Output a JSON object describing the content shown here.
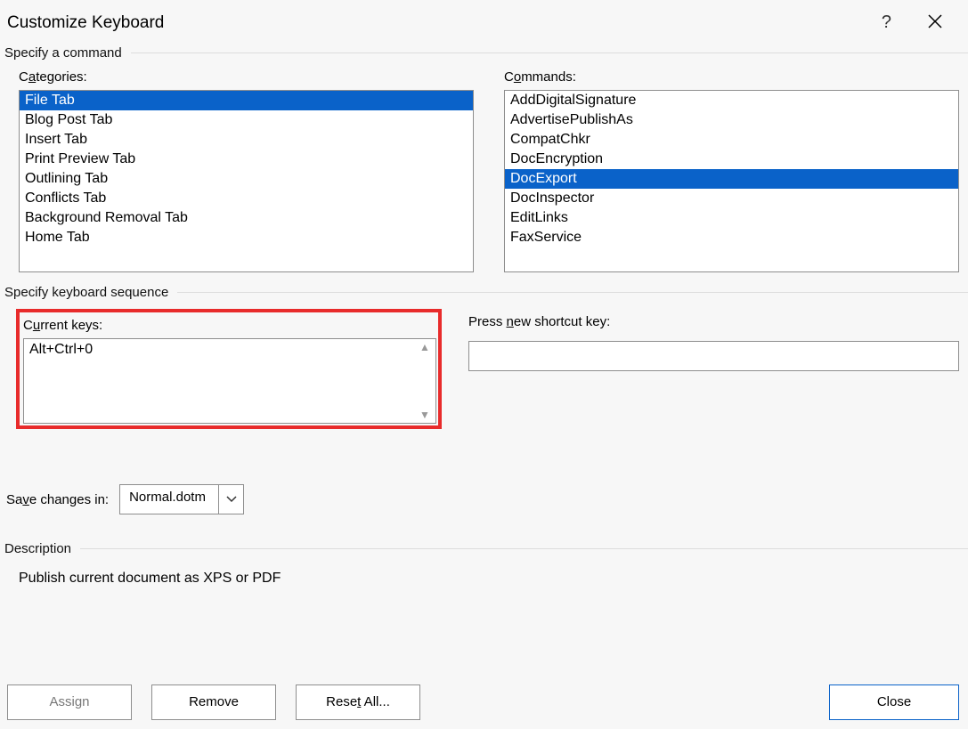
{
  "dialog": {
    "title": "Customize Keyboard"
  },
  "sections": {
    "specify_command": "Specify a command",
    "specify_sequence": "Specify keyboard sequence",
    "description_label": "Description"
  },
  "labels": {
    "categories_pre": "C",
    "categories_u": "a",
    "categories_post": "tegories:",
    "commands_pre": "C",
    "commands_u": "o",
    "commands_post": "mmands:",
    "current_pre": "C",
    "current_u": "u",
    "current_post": "rrent keys:",
    "press_pre": "Press ",
    "press_u": "n",
    "press_post": "ew shortcut key:",
    "savein_pre": "Sa",
    "savein_u": "v",
    "savein_post": "e changes in:"
  },
  "categories": {
    "selected_index": 0,
    "items": [
      "File Tab",
      "Blog Post Tab",
      "Insert Tab",
      "Print Preview Tab",
      "Outlining Tab",
      "Conflicts Tab",
      "Background Removal Tab",
      "Home Tab"
    ]
  },
  "commands": {
    "selected_index": 4,
    "items": [
      "AddDigitalSignature",
      "AdvertisePublishAs",
      "CompatChkr",
      "DocEncryption",
      "DocExport",
      "DocInspector",
      "EditLinks",
      "FaxService"
    ]
  },
  "current_keys": [
    "Alt+Ctrl+0"
  ],
  "new_shortcut": "",
  "save_in": {
    "value": "Normal.dotm"
  },
  "description": "Publish current document as XPS or PDF",
  "buttons": {
    "assign": "Assign",
    "remove": "Remove",
    "resetall_pre": "Rese",
    "resetall_u": "t",
    "resetall_post": " All...",
    "close": "Close"
  }
}
